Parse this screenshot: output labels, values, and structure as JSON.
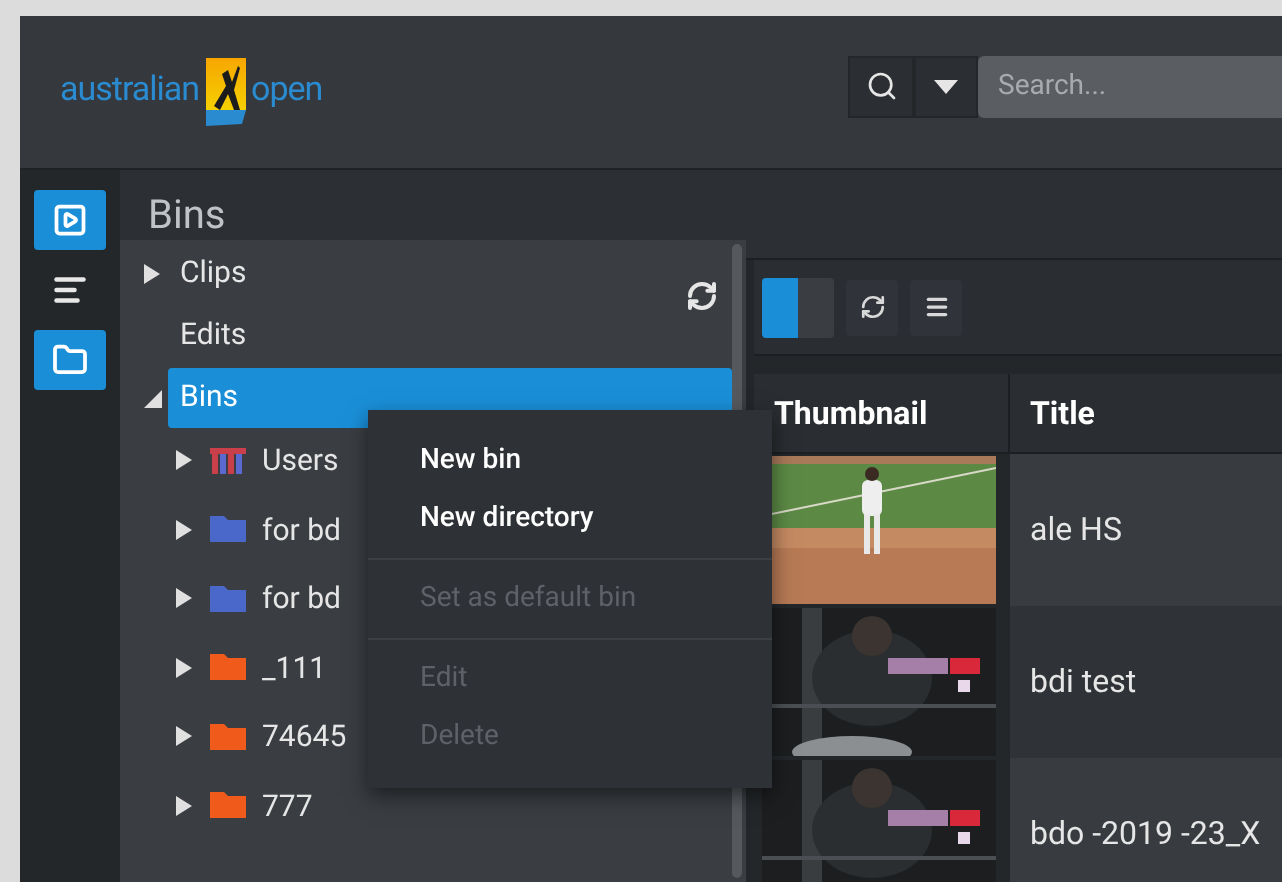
{
  "header": {
    "logo": {
      "left": "australian",
      "right": "open"
    },
    "search": {
      "placeholder": "Search..."
    }
  },
  "rail": [
    {
      "kind": "player",
      "selected": true
    },
    {
      "kind": "timeline",
      "selected": false
    },
    {
      "kind": "bins",
      "selected": true
    }
  ],
  "panel_title": "Bins",
  "tree": [
    {
      "label": "Clips",
      "expanded": false,
      "selected": false,
      "has_children": true
    },
    {
      "label": "Edits",
      "selected": false,
      "has_children": false
    },
    {
      "label": "Bins",
      "expanded": true,
      "selected": true,
      "has_children": true,
      "children": [
        {
          "label": "Users",
          "kind": "library"
        },
        {
          "label": "for bd",
          "kind": "folder",
          "color": "#4a68c9"
        },
        {
          "label": "for bd",
          "kind": "folder",
          "color": "#4a68c9"
        },
        {
          "label": "_111",
          "kind": "folder",
          "color": "#f05a1a"
        },
        {
          "label": "74645",
          "kind": "folder",
          "color": "#f05a1a"
        },
        {
          "label": "777",
          "kind": "folder",
          "color": "#f05a1a"
        }
      ]
    }
  ],
  "context_menu": [
    [
      {
        "label": "New bin",
        "disabled": false
      },
      {
        "label": "New directory",
        "disabled": false
      }
    ],
    [
      {
        "label": "Set as default bin",
        "disabled": true
      }
    ],
    [
      {
        "label": "Edit",
        "disabled": true
      },
      {
        "label": "Delete",
        "disabled": true
      }
    ]
  ],
  "view_toggle": {
    "level": 0.5
  },
  "table": {
    "columns": [
      "Thumbnail",
      "Title"
    ],
    "rows": [
      {
        "title": "ale HS"
      },
      {
        "title": "bdi test"
      },
      {
        "title": "bdo -2019 -23_X"
      }
    ]
  }
}
